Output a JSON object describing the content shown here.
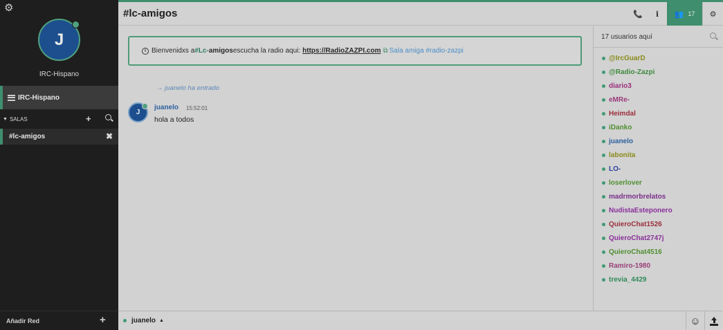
{
  "sidebar": {
    "avatar_initial": "J",
    "network_label": "IRC-Hispano",
    "network_item": "IRC-Hispano",
    "section_label": "SALAS",
    "channels": [
      {
        "name": "#lc-amigos"
      }
    ],
    "add_network_label": "Añadir Red"
  },
  "header": {
    "channel_title": "#lc-amigos",
    "user_count": "17"
  },
  "topic": {
    "prefix": "Bienvenidxs a ",
    "chan_part": "#Lc-",
    "amigos_part": "amigos",
    "middle": " escucha la radio aqui: ",
    "link": "https://RadioZAZPI.com",
    "sala_text": "Sala amiga #radio-zazpi"
  },
  "messages": {
    "join_text": "juanelo ha entrado",
    "join_nick": "juanelo",
    "join_suffix": "ha entrado",
    "nick": "juanelo",
    "avatar_initial": "J",
    "time": "15:52:01",
    "text": "hola a todos"
  },
  "userlist": {
    "header": "17 usuarios aquí",
    "users": [
      {
        "nick": "@IrcGuarD",
        "color": "#8a8a1a"
      },
      {
        "nick": "@Radio-Zazpi",
        "color": "#3e8a3e"
      },
      {
        "nick": "diario3",
        "color": "#9a2f7a"
      },
      {
        "nick": "eMRe-",
        "color": "#9a3a7a"
      },
      {
        "nick": "Heimdal",
        "color": "#9a2f3a"
      },
      {
        "nick": "iDanko",
        "color": "#4f8f2f"
      },
      {
        "nick": "juanelo",
        "color": "#2b5f9e"
      },
      {
        "nick": "labonita",
        "color": "#8a8a1a"
      },
      {
        "nick": "LO-",
        "color": "#2b3f9e"
      },
      {
        "nick": "loserlover",
        "color": "#4f8f2f"
      },
      {
        "nick": "madrmorbrelatos",
        "color": "#7a2f8a"
      },
      {
        "nick": "NudistaEsteponero",
        "color": "#8a2f9a"
      },
      {
        "nick": "QuieroChat1526",
        "color": "#9a2f3a"
      },
      {
        "nick": "QuieroChat2747j",
        "color": "#8a2f9a"
      },
      {
        "nick": "QuieroChat4516",
        "color": "#4f8f2f"
      },
      {
        "nick": "Ramiro-1980",
        "color": "#9a3f7a"
      },
      {
        "nick": "trevia_4429",
        "color": "#2f8a5a"
      }
    ]
  },
  "inputbar": {
    "nick": "juanelo"
  },
  "colors": {
    "accent": "#3f8e6e",
    "sidebar_bg": "#1e1e1e",
    "main_bg": "#d2d2d2",
    "avatar_bg": "#1d4f8e"
  }
}
